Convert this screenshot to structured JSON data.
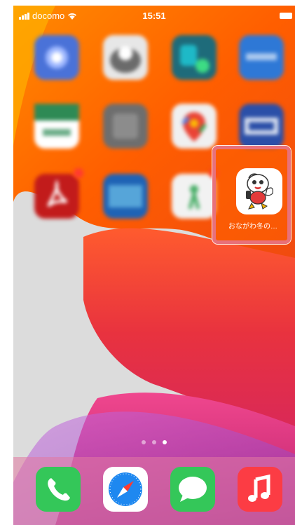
{
  "status_bar": {
    "carrier": "docomo",
    "time": "15:51"
  },
  "home_screen": {
    "apps": [
      {
        "icon": "blurred-app-icon",
        "color": "#4a72d8"
      },
      {
        "icon": "blurred-app-icon",
        "color": "#8a8a8a"
      },
      {
        "icon": "blurred-app-icon",
        "color": "#1e6b7a"
      },
      {
        "icon": "blurred-app-icon",
        "color": "#2e78d6"
      },
      {
        "icon": "blurred-app-icon",
        "color": "#2e8a55"
      },
      {
        "icon": "blurred-app-icon",
        "color": "#6e6e6e"
      },
      {
        "icon": "maps-app-icon",
        "color": "#e8e8e8"
      },
      {
        "icon": "blurred-app-icon",
        "color": "#2b4fa8"
      },
      {
        "icon": "pdf-app-icon",
        "color": "#c21b1b"
      },
      {
        "icon": "blurred-app-icon",
        "color": "#1f63b5"
      },
      {
        "icon": "blurred-app-icon",
        "color": "#f2f2f2"
      }
    ],
    "highlighted_app": {
      "label": "おながわ冬の…",
      "icon": "mascot-bird-icon"
    },
    "page_indicator": {
      "count": 3,
      "active": 3
    }
  },
  "dock": {
    "apps": [
      {
        "icon": "phone-icon",
        "color": "#34c759"
      },
      {
        "icon": "safari-icon",
        "color": "#ffffff"
      },
      {
        "icon": "messages-icon",
        "color": "#34c759"
      },
      {
        "icon": "music-icon",
        "color": "#fc3c44"
      }
    ]
  },
  "colors": {
    "wallpaper_orange": "#ff6a00",
    "wallpaper_red": "#e8383a",
    "highlight_border": "#e8717a"
  }
}
